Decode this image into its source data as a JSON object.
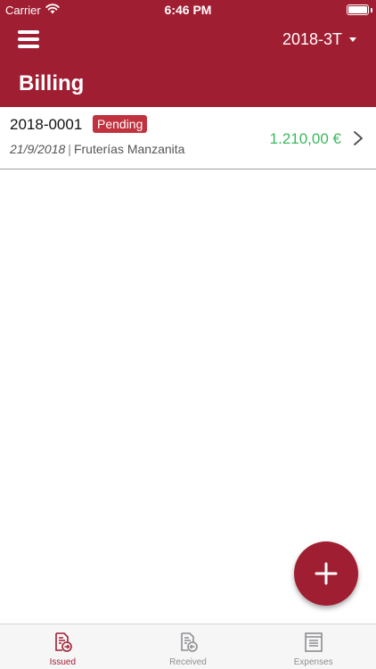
{
  "status_bar": {
    "carrier": "Carrier",
    "time": "6:46 PM"
  },
  "header": {
    "period": "2018-3T",
    "title": "Billing"
  },
  "invoices": [
    {
      "number": "2018-0001",
      "status": "Pending",
      "date": "21/9/2018",
      "client": "Fruterías Manzanita",
      "amount": "1.210,00 €"
    }
  ],
  "tabs": [
    {
      "label": "Issued",
      "icon": "invoice-issued-icon",
      "active": true
    },
    {
      "label": "Received",
      "icon": "invoice-received-icon",
      "active": false
    },
    {
      "label": "Expenses",
      "icon": "expenses-icon",
      "active": false
    }
  ],
  "colors": {
    "brand": "#a01e32",
    "badge": "#c0323f",
    "amount": "#3cb85d",
    "inactive_tab": "#8e8e93"
  }
}
